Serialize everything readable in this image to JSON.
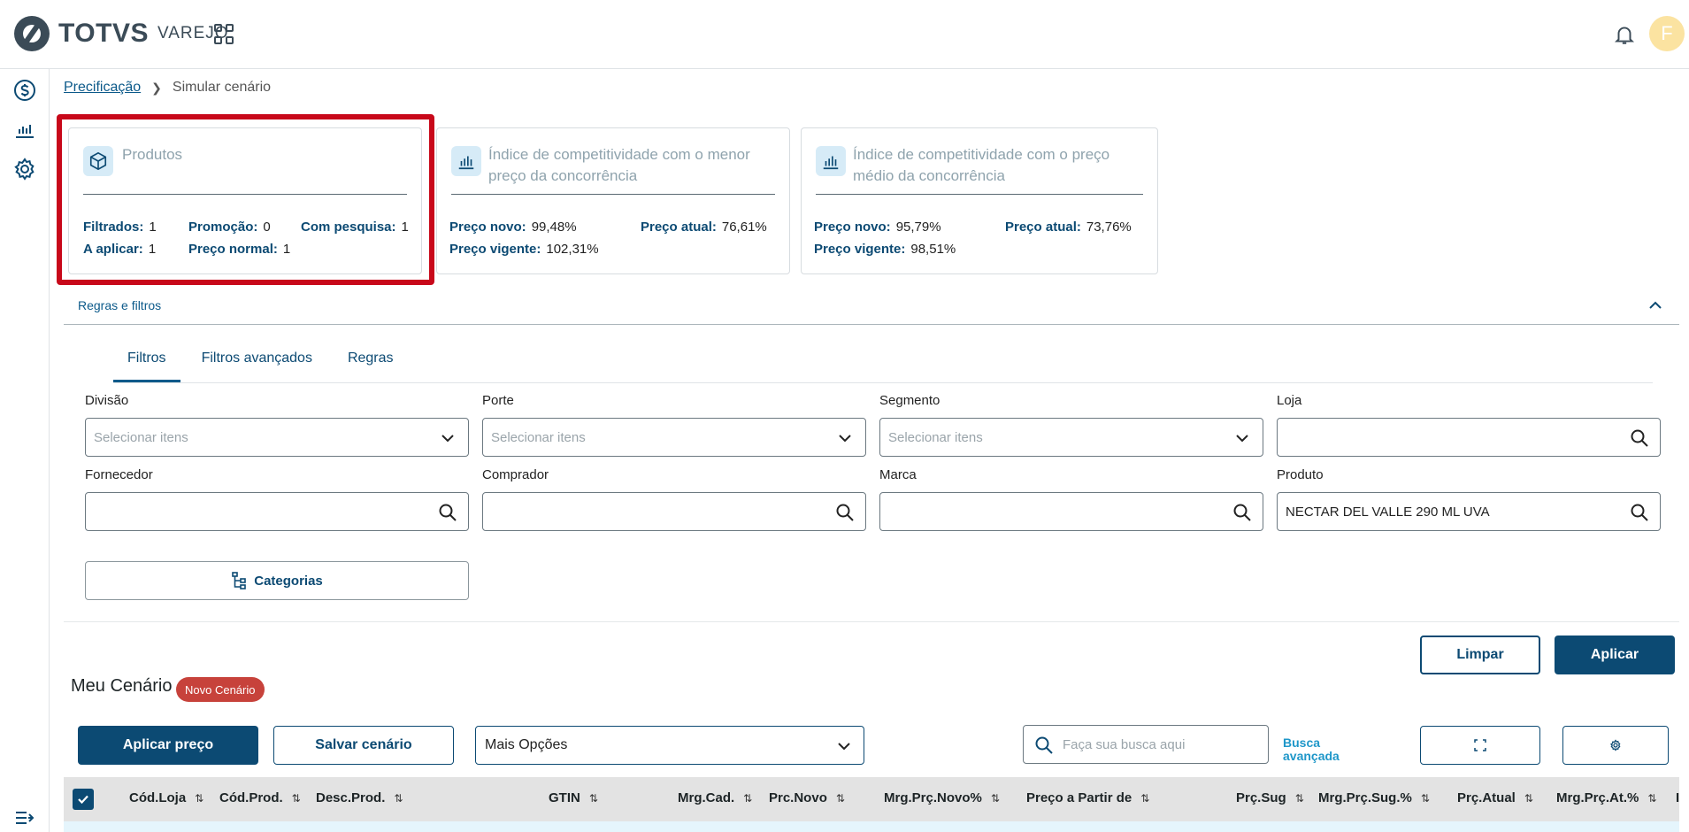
{
  "header": {
    "brand": "TOTVS",
    "product": "VAREJO",
    "user_initial": "F"
  },
  "breadcrumb": {
    "parent": "Precificação",
    "current": "Simular cenário"
  },
  "cards": {
    "produtos": {
      "title": "Produtos",
      "filtrados_label": "Filtrados:",
      "filtrados": "1",
      "promocao_label": "Promoção:",
      "promocao": "0",
      "pesquisa_label": "Com pesquisa:",
      "pesquisa": "1",
      "aplicar_label": "A aplicar:",
      "aplicar": "1",
      "normal_label": "Preço normal:",
      "normal": "1"
    },
    "menor": {
      "title_line1": "Índice de competitividade com o menor",
      "title_line2": "preço da concorrência",
      "novo_label": "Preço novo:",
      "novo": "99,48%",
      "atual_label": "Preço atual:",
      "atual": "76,61%",
      "vigente_label": "Preço vigente:",
      "vigente": "102,31%"
    },
    "medio": {
      "title_line1": "Índice de competitividade com o preço",
      "title_line2": "médio da concorrência",
      "novo_label": "Preço novo:",
      "novo": "95,79%",
      "atual_label": "Preço atual:",
      "atual": "73,76%",
      "vigente_label": "Preço vigente:",
      "vigente": "98,51%"
    }
  },
  "section": {
    "label": "Regras e filtros"
  },
  "tabs": [
    "Filtros",
    "Filtros avançados",
    "Regras"
  ],
  "filters": {
    "divisao": {
      "label": "Divisão",
      "placeholder": "Selecionar itens"
    },
    "porte": {
      "label": "Porte",
      "placeholder": "Selecionar itens"
    },
    "segmento": {
      "label": "Segmento",
      "placeholder": "Selecionar itens"
    },
    "loja": {
      "label": "Loja",
      "value": ""
    },
    "fornecedor": {
      "label": "Fornecedor",
      "value": ""
    },
    "comprador": {
      "label": "Comprador",
      "value": ""
    },
    "marca": {
      "label": "Marca",
      "value": ""
    },
    "produto": {
      "label": "Produto",
      "value": "NECTAR DEL VALLE 290 ML UVA"
    }
  },
  "categorias_label": "Categorias",
  "actions": {
    "limpar": "Limpar",
    "aplicar": "Aplicar"
  },
  "scenario": {
    "title": "Meu Cenário",
    "badge": "Novo Cenário",
    "aplicar_preco": "Aplicar preço",
    "salvar": "Salvar cenário",
    "mais_opcoes": "Mais Opções",
    "search_placeholder": "Faça sua busca aqui",
    "busca_avancada_1": "Busca",
    "busca_avancada_2": "avançada"
  },
  "columns": [
    "Cód.Loja",
    "Cód.Prod.",
    "Desc.Prod.",
    "GTIN",
    "Mrg.Cad.",
    "Prc.Novo",
    "Mrg.Prç.Novo%",
    "Preço a Partir de",
    "Prç.Sug",
    "Mrg.Prç.Sug.%",
    "Prç.Atual",
    "Mrg.Prç.At.%",
    "In"
  ]
}
